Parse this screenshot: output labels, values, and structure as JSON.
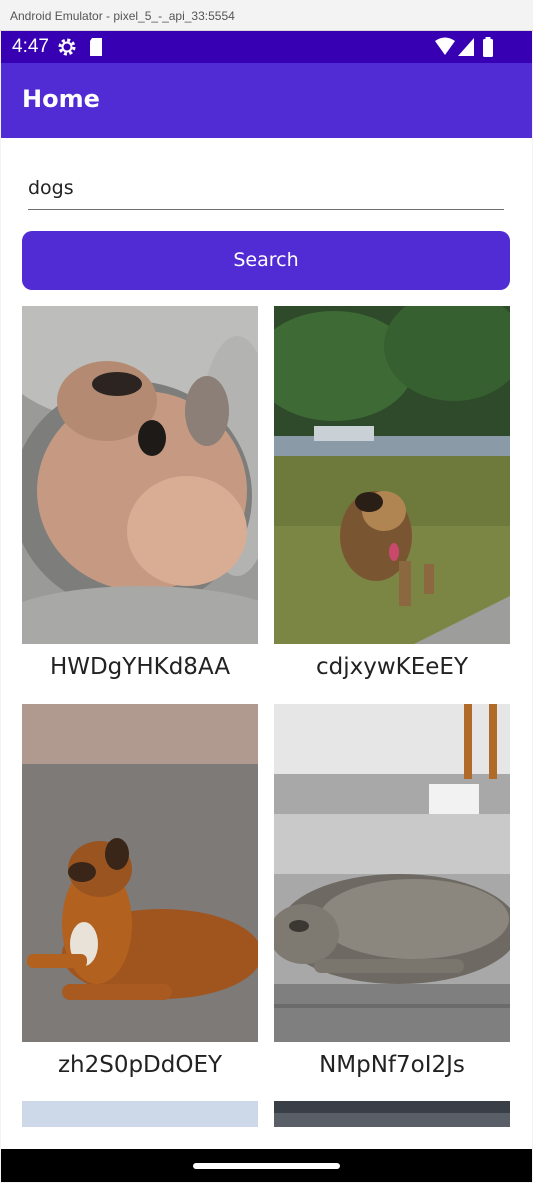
{
  "window": {
    "title": "Android Emulator - pixel_5_-_api_33:5554"
  },
  "status_bar": {
    "time": "4:47",
    "icons": [
      "settings-gear-icon",
      "sd-card-icon",
      "wifi-icon",
      "signal-icon",
      "battery-icon"
    ]
  },
  "app_bar": {
    "title": "Home"
  },
  "search": {
    "value": "dogs",
    "button_label": "Search"
  },
  "results": [
    {
      "caption": "HWDgYHKd8AA",
      "image": "puppy-curled-in-bed-photo"
    },
    {
      "caption": "cdjxywKEeEY",
      "image": "dog-running-on-grass-photo"
    },
    {
      "caption": "zh2S0pDdOEY",
      "image": "dog-lying-on-sand-photo"
    },
    {
      "caption": "NMpNf7oI2Js",
      "image": "brindle-dog-lying-on-pavement-photo"
    }
  ],
  "colors": {
    "primary": "#512bd4",
    "status_bar": "#3700b3"
  }
}
